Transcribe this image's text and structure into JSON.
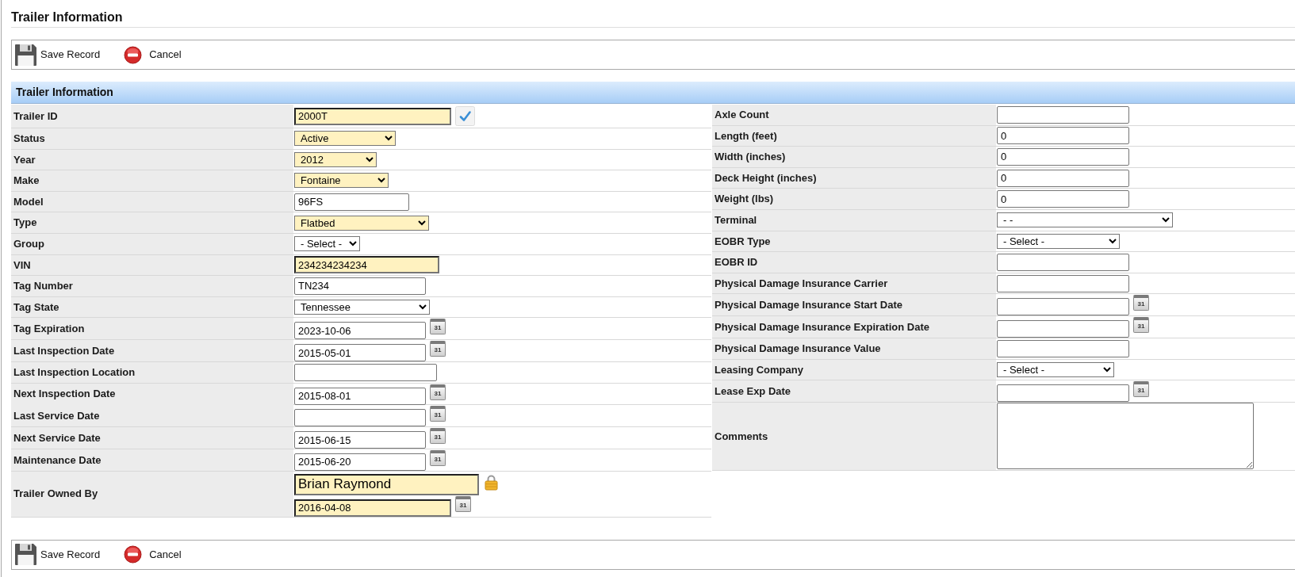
{
  "page_title": "Trailer Information",
  "top_toolbar": {
    "buttons": [
      {
        "kind": "save",
        "label": "Save Record"
      },
      {
        "kind": "cancel",
        "label": "Cancel"
      }
    ]
  },
  "section": {
    "title": "Trailer Information"
  },
  "left_fields": [
    {
      "label": "Trailer ID",
      "kind": "lookup",
      "value": "2000T",
      "highlighted": true
    },
    {
      "label": "Status",
      "kind": "select",
      "value": "Active",
      "highlighted": true
    },
    {
      "label": "Year",
      "kind": "select",
      "value": "2012",
      "highlighted": true
    },
    {
      "label": "Make",
      "kind": "select",
      "value": "Fontaine",
      "highlighted": true
    },
    {
      "label": "Model",
      "kind": "text",
      "value": "96FS",
      "highlighted": false
    },
    {
      "label": "Type",
      "kind": "select",
      "value": "Flatbed",
      "highlighted": true
    },
    {
      "label": "Group",
      "kind": "select",
      "value": "- Select -",
      "highlighted": false
    },
    {
      "label": "VIN",
      "kind": "text",
      "value": "234234234234",
      "highlighted": true
    },
    {
      "label": "Tag Number",
      "kind": "text",
      "value": "TN234",
      "highlighted": false
    },
    {
      "label": "Tag State",
      "kind": "select",
      "value": "Tennessee",
      "highlighted": false
    },
    {
      "label": "Tag Expiration",
      "kind": "date",
      "value": "2023-10-06",
      "calendar": "31",
      "highlighted": false
    },
    {
      "label": "Last Inspection Date",
      "kind": "date",
      "value": "2015-05-01",
      "calendar": "31",
      "highlighted": false
    },
    {
      "label": "Last Inspection Location",
      "kind": "text",
      "highlighted": false
    },
    {
      "label": "Next Inspection Date",
      "kind": "date",
      "value": "2015-08-01",
      "calendar": "31",
      "highlighted": false
    },
    {
      "label": "Last Service Date",
      "kind": "date",
      "calendar": "31",
      "highlighted": false
    },
    {
      "label": "Next Service Date",
      "kind": "date",
      "value": "2015-06-15",
      "calendar": "31",
      "highlighted": false
    },
    {
      "label": "Maintenance Date",
      "kind": "date",
      "value": "2015-06-20",
      "calendar": "31",
      "highlighted": false
    },
    {
      "label": "Trailer Owned By",
      "kind": "owner",
      "value": "Brian Raymond",
      "date": "2016-04-08",
      "calendar": "31",
      "highlighted": true
    }
  ],
  "right_fields": [
    {
      "label": "Axle Count",
      "kind": "text",
      "highlighted": false
    },
    {
      "label": "Length (feet)",
      "kind": "text",
      "value": "0",
      "highlighted": false
    },
    {
      "label": "Width (inches)",
      "kind": "text",
      "value": "0",
      "highlighted": false
    },
    {
      "label": "Deck Height (inches)",
      "kind": "text",
      "value": "0",
      "highlighted": false
    },
    {
      "label": "Weight (lbs)",
      "kind": "text",
      "value": "0",
      "highlighted": false
    },
    {
      "label": "Terminal",
      "kind": "select",
      "value": "- -",
      "highlighted": false
    },
    {
      "label": "EOBR Type",
      "kind": "select",
      "value": "- Select -",
      "highlighted": false
    },
    {
      "label": "EOBR ID",
      "kind": "text",
      "highlighted": false
    },
    {
      "label": "Physical Damage Insurance Carrier",
      "kind": "text",
      "highlighted": false
    },
    {
      "label": "Physical Damage Insurance Start Date",
      "kind": "date",
      "calendar": "31",
      "highlighted": false
    },
    {
      "label": "Physical Damage Insurance Expiration Date",
      "kind": "date",
      "calendar": "31",
      "highlighted": false
    },
    {
      "label": "Physical Damage Insurance Value",
      "kind": "text",
      "highlighted": false
    },
    {
      "label": "Leasing Company",
      "kind": "select",
      "value": "- Select -",
      "highlighted": false
    },
    {
      "label": "Lease Exp Date",
      "kind": "date",
      "calendar": "31",
      "highlighted": false
    },
    {
      "label": "Comments",
      "kind": "textarea",
      "highlighted": false
    }
  ],
  "bottom_toolbar": {
    "buttons": [
      {
        "kind": "save",
        "label": "Save Record"
      },
      {
        "kind": "cancel",
        "label": "Cancel"
      }
    ]
  }
}
